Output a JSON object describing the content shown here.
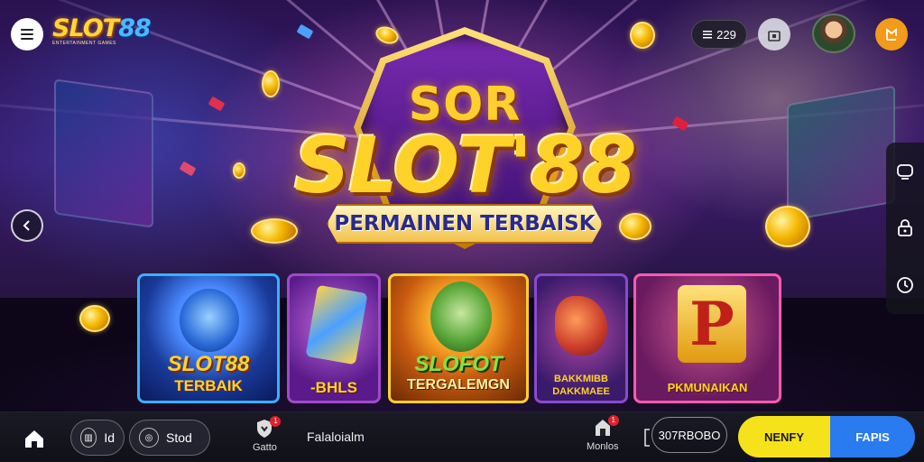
{
  "header": {
    "logo_text_main": "SLOT",
    "logo_text_num": "88",
    "logo_subtitle": "ENTERTAINMENT GAMES",
    "counter_value": "229",
    "colors": {
      "logo_gold": "#ffd53a",
      "logo_blue": "#4ab8ff",
      "flag_button": "#f29a1a"
    }
  },
  "hero": {
    "top_text": "SOR",
    "main_text": "SLOT'88",
    "ribbon_text": "PERMAINEN TERBAISK"
  },
  "games": [
    {
      "line1": "SLOT88",
      "line2": "TERBAIK"
    },
    {
      "line1": "-BHLS"
    },
    {
      "line1": "SLOFOT",
      "line2": "TERGALEMGN"
    },
    {
      "line1": "BAKKMIBB",
      "line2": "DAKKMAEE"
    },
    {
      "line1": "PKMUNAIKAN"
    }
  ],
  "bottom_bar": {
    "pill1_text": "Id",
    "pill2_text": "Stod",
    "nav_left_label": "Gatto",
    "nav_left_badge": "1",
    "center_text": "Falaloialm",
    "nav_right_label": "Monlos",
    "nav_right_badge": "1",
    "code_text": "307RBOBO",
    "cta_primary": "NENFY",
    "cta_secondary": "FAPIS",
    "colors": {
      "cta_yellow": "#f6e21a",
      "cta_blue": "#2a7af0"
    }
  },
  "icons": {
    "menu": "hamburger-icon",
    "gift": "gift-icon",
    "flag": "flag-icon",
    "back": "chevron-left-icon",
    "side": [
      "chat-icon",
      "lock-icon",
      "clock-icon"
    ],
    "home": "home-icon"
  }
}
